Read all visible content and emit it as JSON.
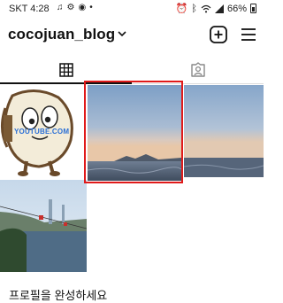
{
  "status_bar": {
    "time": "SKT 4:28",
    "battery": "66%",
    "left_icons": [
      "music-note-icon",
      "settings-icon",
      "chat-icon",
      "dot-icon"
    ],
    "right_icons": [
      "alarm-icon",
      "bluetooth-icon",
      "wifi-icon",
      "signal-icon",
      "battery-icon"
    ]
  },
  "header": {
    "username": "cocojuan_blog",
    "icons": [
      "chevron-down-icon",
      "add-post-icon",
      "menu-icon"
    ]
  },
  "tabs": [
    {
      "name": "grid",
      "icon": "grid-icon",
      "active": true
    },
    {
      "name": "tagged",
      "icon": "tagged-person-icon",
      "active": false
    }
  ],
  "posts": [
    {
      "id": "illustration",
      "overlay_text": "YOUTUBE.COM"
    },
    {
      "id": "sunset-sea-1",
      "selected": true
    },
    {
      "id": "sunset-sea-2"
    },
    {
      "id": "cable-car-bay"
    }
  ],
  "selection_color": "#e01a1a",
  "complete_profile_label": "프로필을 완성하세요"
}
